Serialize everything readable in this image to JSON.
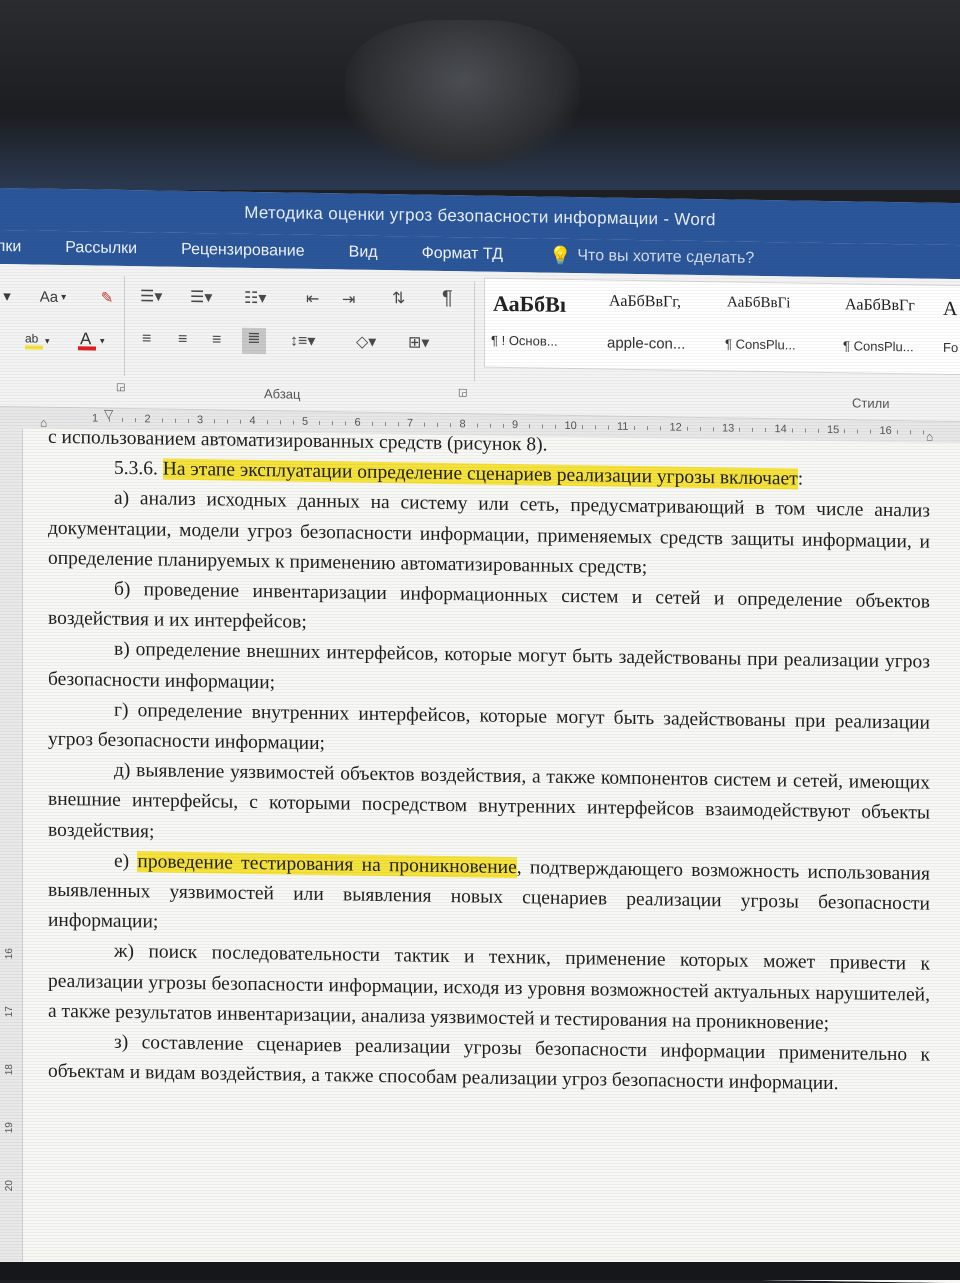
{
  "window": {
    "title": "Методика оценки угроз безопасности информации - Word"
  },
  "tabs": [
    {
      "label": "лки"
    },
    {
      "label": "Рассылки"
    },
    {
      "label": "Рецензирование"
    },
    {
      "label": "Вид"
    },
    {
      "label": "Формат ТД"
    }
  ],
  "tell_me": {
    "placeholder": "Что вы хотите сделать?"
  },
  "ribbon": {
    "font_case_label": "Aa",
    "paragraph_mark": "¶",
    "paragraph_group_label": "Абзац",
    "styles_group_label": "Стили",
    "styles": [
      {
        "sample": "АаБбВı",
        "name": "¶ ! Основ..."
      },
      {
        "sample": "АаБбВвГг,",
        "name": "apple-con..."
      },
      {
        "sample": "АаБбВвГі",
        "name": "¶ ConsPlu..."
      },
      {
        "sample": "АаБбВвГг",
        "name": "¶ ConsPlu..."
      },
      {
        "sample": "А",
        "name": "Fo"
      }
    ]
  },
  "ruler": {
    "numbers": [
      "1",
      "2",
      "3",
      "4",
      "5",
      "6",
      "7",
      "8",
      "9",
      "10",
      "11",
      "12",
      "13",
      "14",
      "15",
      "16"
    ],
    "vertical_numbers": [
      "16",
      "17",
      "18",
      "19",
      "20"
    ]
  },
  "document": {
    "line0": "с использованием автоматизированных средств (рисунок 8).",
    "p536_num": "5.3.6.",
    "p536_hl": "На этапе эксплуатации определение сценариев реализации угрозы включает",
    "p536_tail": ":",
    "item_a": "а) анализ исходных данных на систему или сеть, предусматривающий в том числе анализ документации, модели угроз безопасности информации, применяемых средств защиты информации, и определение планируемых к применению автоматизированных средств;",
    "item_b": "б) проведение инвентаризации информационных систем и сетей и определение объектов воздействия и их интерфейсов;",
    "item_v": "в) определение внешних интерфейсов, которые могут быть задействованы при реализации угроз безопасности информации;",
    "item_g": "г) определение внутренних интерфейсов, которые могут быть задействованы при реализации угроз безопасности информации;",
    "item_d": "д) выявление уязвимостей объектов воздействия, а также компонентов систем и сетей, имеющих внешние интерфейсы, с которыми посредством внутренних интерфейсов взаимодействуют объекты воздействия;",
    "item_e_prefix": "е)",
    "item_e_hl": "проведение тестирования на проникновение",
    "item_e_rest": ", подтверждающего возможность использования выявленных уязвимостей или выявления новых сценариев реализации угрозы безопасности информации;",
    "item_zh": "ж) поиск последовательности тактик и техник, применение которых может привести к реализации угрозы безопасности информации, исходя из уровня возможностей актуальных нарушителей, а также результатов инвентаризации, анализа уязвимостей и тестирования на проникновение;",
    "item_z": "з) составление сценариев реализации угрозы безопасности информации применительно к объектам и видам воздействия, а также способам реализации угроз безопасности информации."
  },
  "colors": {
    "title_bar": "#2b579a",
    "highlight": "#f5e23a"
  }
}
